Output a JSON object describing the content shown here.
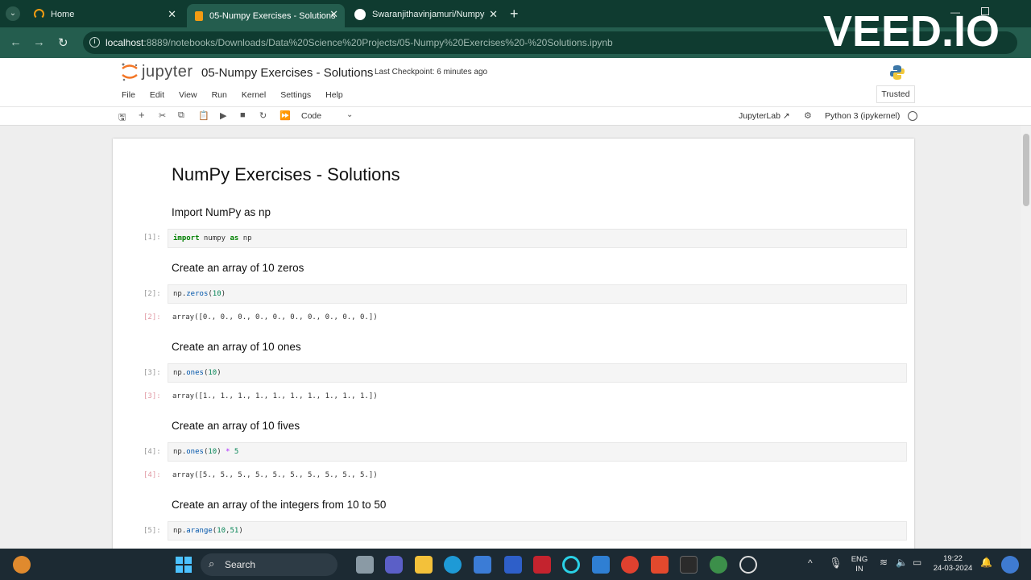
{
  "browser": {
    "tabs": [
      {
        "label": "Home",
        "active": false
      },
      {
        "label": "05-Numpy Exercises - Solutions",
        "active": true
      },
      {
        "label": "Swaranjithavinjamuri/Numpy-E",
        "active": false
      }
    ],
    "url_host": "localhost",
    "url_path": ":8889/notebooks/Downloads/Data%20Science%20Projects/05-Numpy%20Exercises%20-%20Solutions.ipynb",
    "watermark": "VEED.IO"
  },
  "jupyter": {
    "logo_text": "jupyter",
    "notebook_title": "05-Numpy Exercises - Solutions",
    "checkpoint": "Last Checkpoint: 6 minutes ago",
    "menu": [
      "File",
      "Edit",
      "View",
      "Run",
      "Kernel",
      "Settings",
      "Help"
    ],
    "trusted": "Trusted",
    "cell_type": "Code",
    "jupyterlab_label": "JupyterLab",
    "kernel": "Python 3 (ipykernel)"
  },
  "notebook": {
    "title": "NumPy Exercises - Solutions",
    "cells": [
      {
        "md": "Import NumPy as np",
        "prompt": "[1]:",
        "code": "import numpy as np",
        "out_prompt": "",
        "output": ""
      },
      {
        "md": "Create an array of 10 zeros",
        "prompt": "[2]:",
        "code": "np.zeros(10)",
        "out_prompt": "[2]:",
        "output": "array([0., 0., 0., 0., 0., 0., 0., 0., 0., 0.])"
      },
      {
        "md": "Create an array of 10 ones",
        "prompt": "[3]:",
        "code": "np.ones(10)",
        "out_prompt": "[3]:",
        "output": "array([1., 1., 1., 1., 1., 1., 1., 1., 1., 1.])"
      },
      {
        "md": "Create an array of 10 fives",
        "prompt": "[4]:",
        "code": "np.ones(10) * 5",
        "out_prompt": "[4]:",
        "output": "array([5., 5., 5., 5., 5., 5., 5., 5., 5., 5.])"
      },
      {
        "md": "Create an array of the integers from 10 to 50",
        "prompt": "[5]:",
        "code": "np.arange(10,51)",
        "out_prompt": "",
        "output": ""
      }
    ]
  },
  "taskbar": {
    "search_label": "Search",
    "lang_line1": "ENG",
    "lang_line2": "IN",
    "time": "19:22",
    "date": "24-03-2024"
  },
  "colors": {
    "tabbar_bg": "#0f3b30",
    "addrbar_bg": "#245d4e",
    "taskbar_bg": "#1c2a33"
  }
}
